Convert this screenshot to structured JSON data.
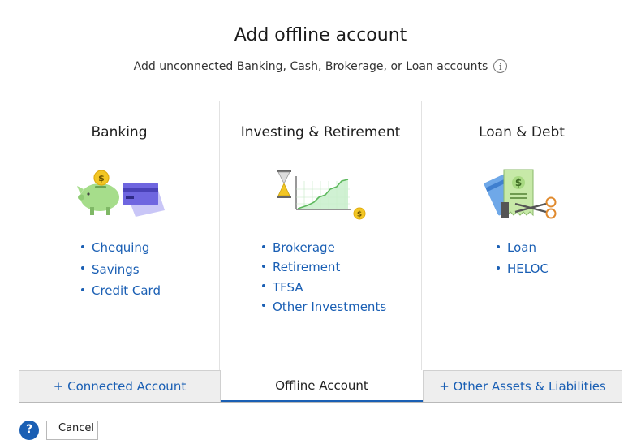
{
  "header": {
    "title": "Add offline account",
    "subtitle": "Add unconnected Banking, Cash, Brokerage, or Loan accounts",
    "info_icon": "info-icon"
  },
  "columns": [
    {
      "title": "Banking",
      "illustration": "piggy-bank-and-card-icon",
      "links": [
        "Chequing",
        "Savings",
        "Credit Card"
      ]
    },
    {
      "title": "Investing & Retirement",
      "illustration": "hourglass-and-growth-chart-icon",
      "links": [
        "Brokerage",
        "Retirement",
        "TFSA",
        "Other Investments"
      ]
    },
    {
      "title": "Loan & Debt",
      "illustration": "receipt-and-scissors-icon",
      "links": [
        "Loan",
        "HELOC"
      ]
    }
  ],
  "tabs": {
    "connected": "+ Connected Account",
    "offline": "Offline Account",
    "other": "+ Other Assets & Liabilities",
    "active": "offline"
  },
  "footer": {
    "help_icon": "?",
    "button_label": "Cancel"
  },
  "colors": {
    "link": "#1a5fb4",
    "tab_inactive_bg": "#eeeeee",
    "panel_border": "#b9b9b9"
  }
}
